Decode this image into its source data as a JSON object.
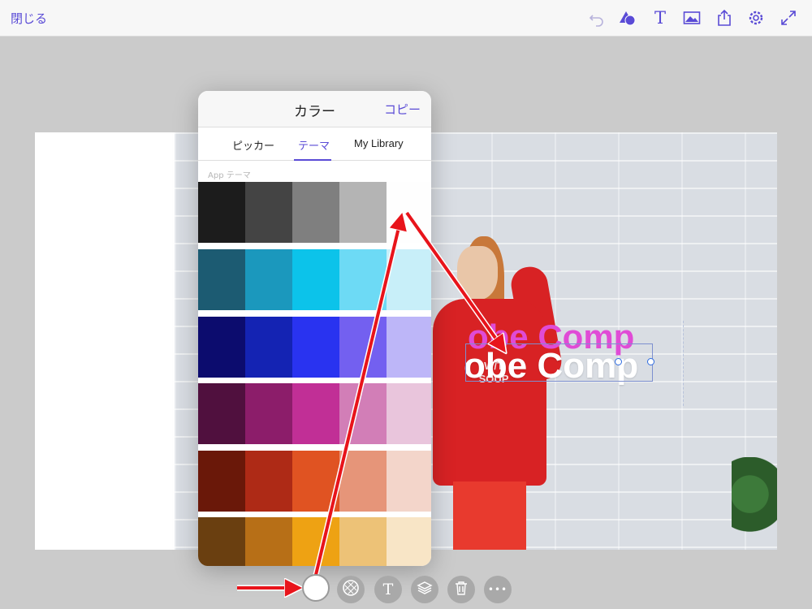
{
  "topbar": {
    "close_label": "閉じる",
    "icons": [
      "undo-icon",
      "shape-icon",
      "text-icon",
      "image-icon",
      "share-icon",
      "settings-icon",
      "expand-icon"
    ]
  },
  "canvas": {
    "headline_pink": "obe Comp",
    "headline_white": "obe Comp",
    "shirt_print_line1": "W/T",
    "shirt_print_line2": "SOUP"
  },
  "color_panel": {
    "title": "カラー",
    "copy_label": "コピー",
    "tabs": [
      {
        "label": "ピッカー",
        "active": false
      },
      {
        "label": "テーマ",
        "active": true
      },
      {
        "label": "My Library",
        "active": false
      }
    ],
    "section_label": "App テーマ",
    "swatch_rows": [
      [
        "#1c1c1c",
        "#444444",
        "#7f7f7f",
        "#b4b4b4",
        "#fefefe"
      ],
      [
        "#1c5b72",
        "#1b98bd",
        "#0cc3ea",
        "#6ddaf5",
        "#c8eff9"
      ],
      [
        "#0c0c6e",
        "#1423b3",
        "#2933f0",
        "#7360f0",
        "#bdb6f8"
      ],
      [
        "#50103e",
        "#8c1d6a",
        "#c12f96",
        "#d27eb7",
        "#e9c5dc"
      ],
      [
        "#6a1809",
        "#ae2a16",
        "#e05322",
        "#e69579",
        "#f3d5ca"
      ],
      [
        "#6a3f10",
        "#b76f17",
        "#eea213",
        "#edc277",
        "#f8e5c6"
      ]
    ]
  },
  "bottom_toolbar": {
    "buttons": [
      "color-swatch-button",
      "pattern-button",
      "text-button",
      "layers-button",
      "delete-button",
      "more-button"
    ],
    "text_glyph": "T",
    "more_glyph": "•••"
  },
  "colors": {
    "accent": "#5a4bd6",
    "arrow": "#e8141b"
  }
}
